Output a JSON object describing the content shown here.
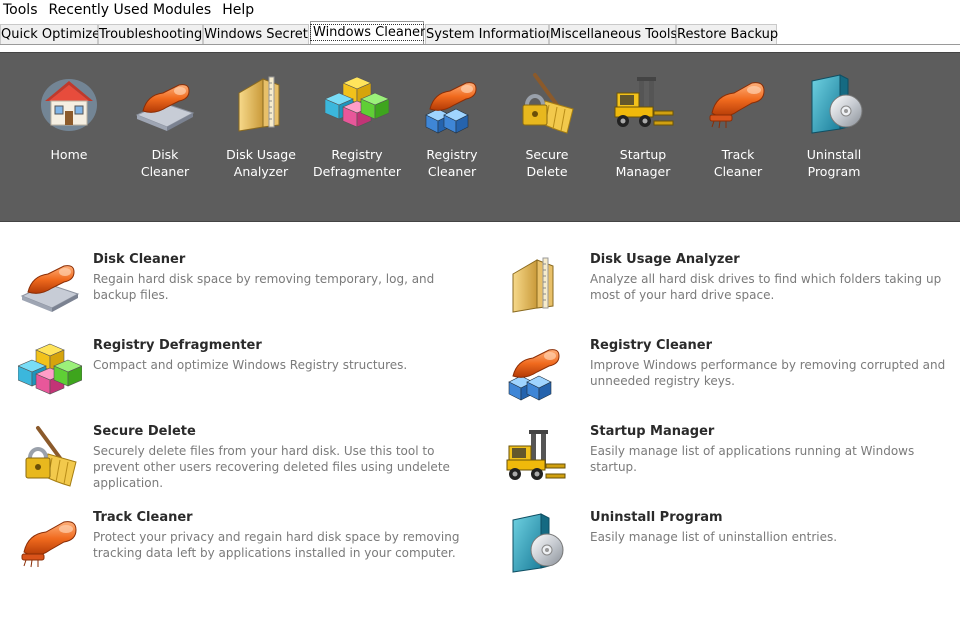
{
  "menu": [
    "Tools",
    "Recently Used Modules",
    "Help"
  ],
  "tabs": [
    {
      "label": "Quick Optimizer",
      "active": false
    },
    {
      "label": "Troubleshooting",
      "active": false
    },
    {
      "label": "Windows Secret",
      "active": false
    },
    {
      "label": "Windows Cleaner",
      "active": true
    },
    {
      "label": "System Information",
      "active": false
    },
    {
      "label": "Miscellaneous Tools",
      "active": false
    },
    {
      "label": "Restore Backup",
      "active": false
    }
  ],
  "toolbar": {
    "background": "#5d5d5d",
    "items": [
      {
        "label": "Home",
        "icon": "home-icon"
      },
      {
        "label": "Disk\nCleaner",
        "icon": "disk-cleaner-icon"
      },
      {
        "label": "Disk Usage\nAnalyzer",
        "icon": "disk-usage-analyzer-icon"
      },
      {
        "label": "Registry\nDefragmenter",
        "icon": "registry-defragmenter-icon"
      },
      {
        "label": "Registry\nCleaner",
        "icon": "registry-cleaner-icon"
      },
      {
        "label": "Secure\nDelete",
        "icon": "secure-delete-icon"
      },
      {
        "label": "Startup\nManager",
        "icon": "startup-manager-icon"
      },
      {
        "label": "Track\nCleaner",
        "icon": "track-cleaner-icon"
      },
      {
        "label": "Uninstall\nProgram",
        "icon": "uninstall-program-icon"
      }
    ]
  },
  "items": [
    {
      "title": "Disk Cleaner",
      "description": "Regain hard disk space by removing temporary, log, and backup files.",
      "icon": "disk-cleaner-icon"
    },
    {
      "title": "Disk Usage Analyzer",
      "description": "Analyze all hard disk drives to find which folders taking up most of your hard drive space.",
      "icon": "disk-usage-analyzer-icon"
    },
    {
      "title": "Registry Defragmenter",
      "description": "Compact and optimize Windows Registry structures.",
      "icon": "registry-defragmenter-icon"
    },
    {
      "title": "Registry Cleaner",
      "description": "Improve Windows performance by removing corrupted and unneeded registry keys.",
      "icon": "registry-cleaner-icon"
    },
    {
      "title": "Secure Delete",
      "description": "Securely delete files from your hard disk. Use this tool to prevent other users recovering deleted files using undelete application.",
      "icon": "secure-delete-icon"
    },
    {
      "title": "Startup Manager",
      "description": "Easily manage list of applications running at Windows startup.",
      "icon": "startup-manager-icon"
    },
    {
      "title": "Track Cleaner",
      "description": "Protect your privacy and regain hard disk space by removing tracking data left by applications installed in your computer.",
      "icon": "track-cleaner-icon"
    },
    {
      "title": "Uninstall Program",
      "description": "Easily manage list of uninstallion entries.",
      "icon": "uninstall-program-icon"
    }
  ]
}
